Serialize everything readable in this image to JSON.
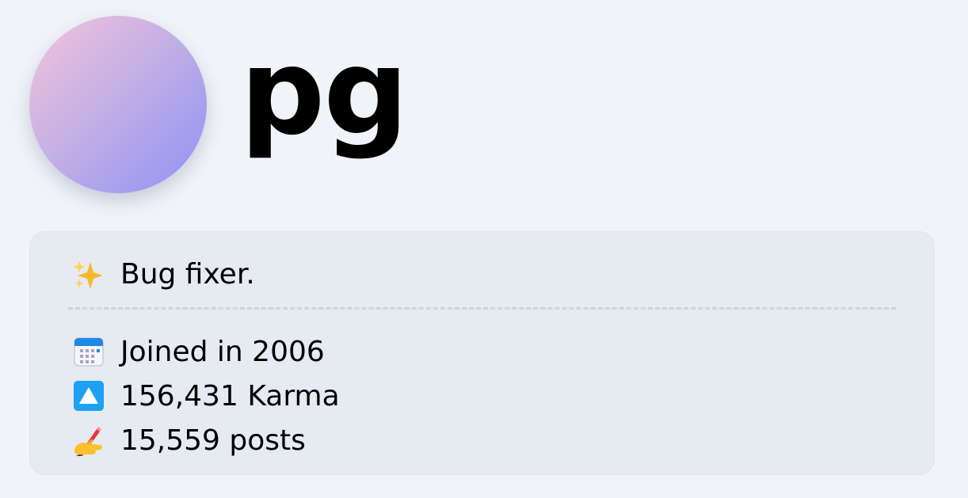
{
  "profile": {
    "username": "pg",
    "bio": "Bug fixer.",
    "bio_icon": "sparkles-icon"
  },
  "stats": [
    {
      "icon": "calendar-icon",
      "text": "Joined in 2006"
    },
    {
      "icon": "up-arrow-icon",
      "text": "156,431 Karma"
    },
    {
      "icon": "writing-hand-icon",
      "text": "15,559 posts"
    }
  ],
  "colors": {
    "background": "#f0f3f8",
    "card": "#e6eaf1",
    "karma_icon": "#1da1f2",
    "avatar_gradient_start": "#f3c4dc",
    "avatar_gradient_end": "#8f92f5"
  }
}
